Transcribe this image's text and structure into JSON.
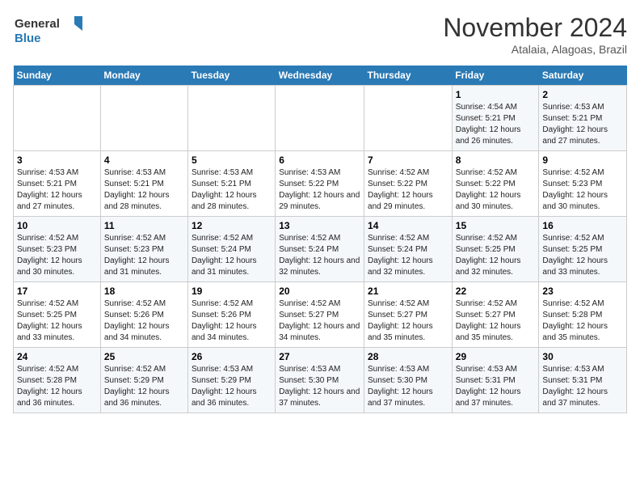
{
  "header": {
    "logo_line1": "General",
    "logo_line2": "Blue",
    "month": "November 2024",
    "location": "Atalaia, Alagoas, Brazil"
  },
  "weekdays": [
    "Sunday",
    "Monday",
    "Tuesday",
    "Wednesday",
    "Thursday",
    "Friday",
    "Saturday"
  ],
  "weeks": [
    [
      {
        "day": "",
        "info": ""
      },
      {
        "day": "",
        "info": ""
      },
      {
        "day": "",
        "info": ""
      },
      {
        "day": "",
        "info": ""
      },
      {
        "day": "",
        "info": ""
      },
      {
        "day": "1",
        "info": "Sunrise: 4:54 AM\nSunset: 5:21 PM\nDaylight: 12 hours and 26 minutes."
      },
      {
        "day": "2",
        "info": "Sunrise: 4:53 AM\nSunset: 5:21 PM\nDaylight: 12 hours and 27 minutes."
      }
    ],
    [
      {
        "day": "3",
        "info": "Sunrise: 4:53 AM\nSunset: 5:21 PM\nDaylight: 12 hours and 27 minutes."
      },
      {
        "day": "4",
        "info": "Sunrise: 4:53 AM\nSunset: 5:21 PM\nDaylight: 12 hours and 28 minutes."
      },
      {
        "day": "5",
        "info": "Sunrise: 4:53 AM\nSunset: 5:21 PM\nDaylight: 12 hours and 28 minutes."
      },
      {
        "day": "6",
        "info": "Sunrise: 4:53 AM\nSunset: 5:22 PM\nDaylight: 12 hours and 29 minutes."
      },
      {
        "day": "7",
        "info": "Sunrise: 4:52 AM\nSunset: 5:22 PM\nDaylight: 12 hours and 29 minutes."
      },
      {
        "day": "8",
        "info": "Sunrise: 4:52 AM\nSunset: 5:22 PM\nDaylight: 12 hours and 30 minutes."
      },
      {
        "day": "9",
        "info": "Sunrise: 4:52 AM\nSunset: 5:23 PM\nDaylight: 12 hours and 30 minutes."
      }
    ],
    [
      {
        "day": "10",
        "info": "Sunrise: 4:52 AM\nSunset: 5:23 PM\nDaylight: 12 hours and 30 minutes."
      },
      {
        "day": "11",
        "info": "Sunrise: 4:52 AM\nSunset: 5:23 PM\nDaylight: 12 hours and 31 minutes."
      },
      {
        "day": "12",
        "info": "Sunrise: 4:52 AM\nSunset: 5:24 PM\nDaylight: 12 hours and 31 minutes."
      },
      {
        "day": "13",
        "info": "Sunrise: 4:52 AM\nSunset: 5:24 PM\nDaylight: 12 hours and 32 minutes."
      },
      {
        "day": "14",
        "info": "Sunrise: 4:52 AM\nSunset: 5:24 PM\nDaylight: 12 hours and 32 minutes."
      },
      {
        "day": "15",
        "info": "Sunrise: 4:52 AM\nSunset: 5:25 PM\nDaylight: 12 hours and 32 minutes."
      },
      {
        "day": "16",
        "info": "Sunrise: 4:52 AM\nSunset: 5:25 PM\nDaylight: 12 hours and 33 minutes."
      }
    ],
    [
      {
        "day": "17",
        "info": "Sunrise: 4:52 AM\nSunset: 5:25 PM\nDaylight: 12 hours and 33 minutes."
      },
      {
        "day": "18",
        "info": "Sunrise: 4:52 AM\nSunset: 5:26 PM\nDaylight: 12 hours and 34 minutes."
      },
      {
        "day": "19",
        "info": "Sunrise: 4:52 AM\nSunset: 5:26 PM\nDaylight: 12 hours and 34 minutes."
      },
      {
        "day": "20",
        "info": "Sunrise: 4:52 AM\nSunset: 5:27 PM\nDaylight: 12 hours and 34 minutes."
      },
      {
        "day": "21",
        "info": "Sunrise: 4:52 AM\nSunset: 5:27 PM\nDaylight: 12 hours and 35 minutes."
      },
      {
        "day": "22",
        "info": "Sunrise: 4:52 AM\nSunset: 5:27 PM\nDaylight: 12 hours and 35 minutes."
      },
      {
        "day": "23",
        "info": "Sunrise: 4:52 AM\nSunset: 5:28 PM\nDaylight: 12 hours and 35 minutes."
      }
    ],
    [
      {
        "day": "24",
        "info": "Sunrise: 4:52 AM\nSunset: 5:28 PM\nDaylight: 12 hours and 36 minutes."
      },
      {
        "day": "25",
        "info": "Sunrise: 4:52 AM\nSunset: 5:29 PM\nDaylight: 12 hours and 36 minutes."
      },
      {
        "day": "26",
        "info": "Sunrise: 4:53 AM\nSunset: 5:29 PM\nDaylight: 12 hours and 36 minutes."
      },
      {
        "day": "27",
        "info": "Sunrise: 4:53 AM\nSunset: 5:30 PM\nDaylight: 12 hours and 37 minutes."
      },
      {
        "day": "28",
        "info": "Sunrise: 4:53 AM\nSunset: 5:30 PM\nDaylight: 12 hours and 37 minutes."
      },
      {
        "day": "29",
        "info": "Sunrise: 4:53 AM\nSunset: 5:31 PM\nDaylight: 12 hours and 37 minutes."
      },
      {
        "day": "30",
        "info": "Sunrise: 4:53 AM\nSunset: 5:31 PM\nDaylight: 12 hours and 37 minutes."
      }
    ]
  ]
}
